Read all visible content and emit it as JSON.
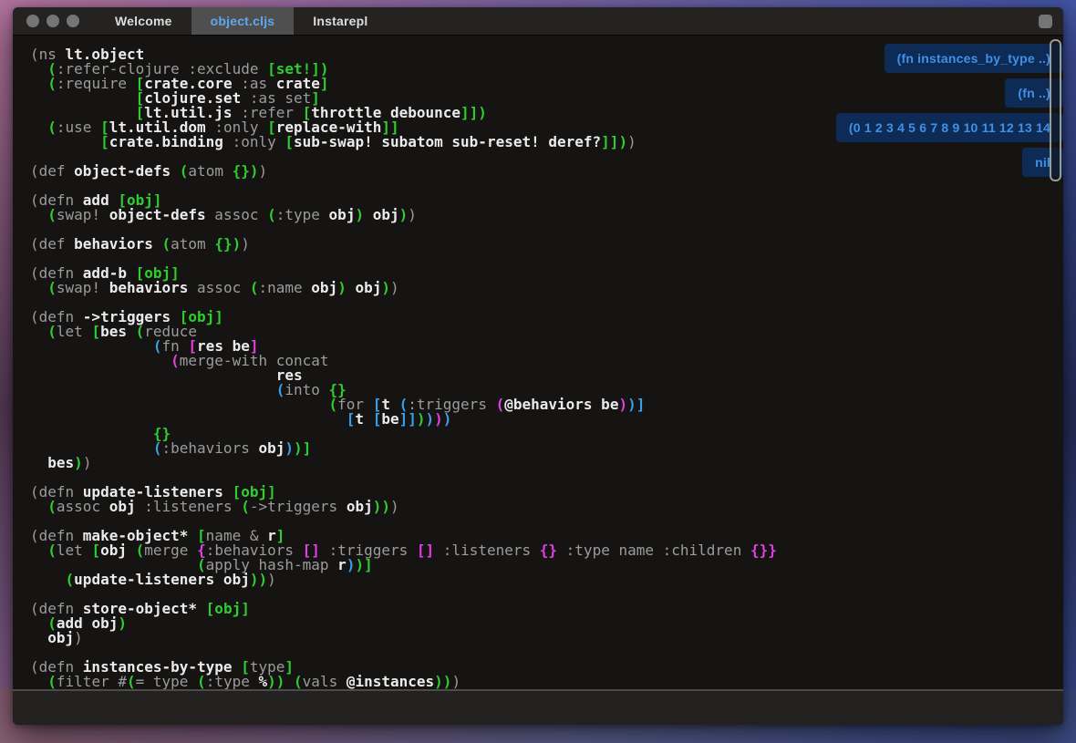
{
  "tabbar": {
    "window_controls": [
      {
        "name": "close-button"
      },
      {
        "name": "minimize-button"
      },
      {
        "name": "zoom-button"
      }
    ],
    "tabs": [
      {
        "label": "Welcome",
        "active": false
      },
      {
        "label": "object.cljs",
        "active": true
      },
      {
        "label": "Instarepl",
        "active": false
      }
    ],
    "console_button": {
      "name": "console-toggle-button"
    }
  },
  "colors": {
    "tab_active_text": "#5da9f0",
    "badge_bg": "#0d2b55",
    "badge_text": "#3f90e8",
    "paren_green": "#2fce2f",
    "paren_blue": "#3c9fe8",
    "paren_magenta": "#e040e0",
    "symbol_white": "#ebebeb",
    "default_gray": "#9c9c9c"
  },
  "editor": {
    "inline_results": [
      {
        "label": "(fn instances_by_type ..)"
      },
      {
        "label": "(fn  ..)"
      },
      {
        "label": "(0 1 2 3 4 5 6 7 8 9 10 11 12 13 14"
      },
      {
        "label": "nil"
      }
    ],
    "lines": [
      [
        [
          "g",
          "(ns "
        ],
        [
          "w",
          "lt.object"
        ]
      ],
      [
        [
          "g",
          "  "
        ],
        [
          "G",
          "("
        ],
        [
          "g",
          ":refer-clojure :exclude "
        ],
        [
          "G",
          "["
        ],
        [
          "G",
          "set!"
        ],
        [
          "G",
          "])"
        ]
      ],
      [
        [
          "g",
          "  "
        ],
        [
          "G",
          "("
        ],
        [
          "g",
          ":require "
        ],
        [
          "G",
          "["
        ],
        [
          "w",
          "crate.core"
        ],
        [
          "g",
          " :as "
        ],
        [
          "w",
          "crate"
        ],
        [
          "G",
          "]"
        ]
      ],
      [
        [
          "g",
          "            "
        ],
        [
          "G",
          "["
        ],
        [
          "w",
          "clojure.set"
        ],
        [
          "g",
          " :as set"
        ],
        [
          "G",
          "]"
        ]
      ],
      [
        [
          "g",
          "            "
        ],
        [
          "G",
          "["
        ],
        [
          "w",
          "lt.util.js"
        ],
        [
          "g",
          " :refer "
        ],
        [
          "G",
          "["
        ],
        [
          "w",
          "throttle debounce"
        ],
        [
          "G",
          "]])"
        ]
      ],
      [
        [
          "g",
          "  "
        ],
        [
          "G",
          "("
        ],
        [
          "g",
          ":use "
        ],
        [
          "G",
          "["
        ],
        [
          "w",
          "lt.util.dom"
        ],
        [
          "g",
          " :only "
        ],
        [
          "G",
          "["
        ],
        [
          "w",
          "replace-with"
        ],
        [
          "G",
          "]]"
        ]
      ],
      [
        [
          "g",
          "        "
        ],
        [
          "G",
          "["
        ],
        [
          "w",
          "crate.binding"
        ],
        [
          "g",
          " :only "
        ],
        [
          "G",
          "["
        ],
        [
          "w",
          "sub-swap! subatom sub-reset! deref?"
        ],
        [
          "G",
          "]])"
        ],
        [
          "g",
          ")"
        ]
      ],
      [],
      [
        [
          "g",
          "(def "
        ],
        [
          "w",
          "object-defs"
        ],
        [
          "g",
          " "
        ],
        [
          "G",
          "("
        ],
        [
          "g",
          "atom "
        ],
        [
          "G",
          "{})"
        ],
        [
          "g",
          ")"
        ]
      ],
      [],
      [
        [
          "g",
          "(defn "
        ],
        [
          "w",
          "add"
        ],
        [
          "g",
          " "
        ],
        [
          "G",
          "[obj]"
        ]
      ],
      [
        [
          "g",
          "  "
        ],
        [
          "G",
          "("
        ],
        [
          "g",
          "swap! "
        ],
        [
          "w",
          "object-defs"
        ],
        [
          "g",
          " assoc "
        ],
        [
          "G",
          "("
        ],
        [
          "g",
          ":type "
        ],
        [
          "w",
          "obj"
        ],
        [
          "G",
          ")"
        ],
        [
          "g",
          " "
        ],
        [
          "w",
          "obj"
        ],
        [
          "G",
          ")"
        ],
        [
          "g",
          ")"
        ]
      ],
      [],
      [
        [
          "g",
          "(def "
        ],
        [
          "w",
          "behaviors"
        ],
        [
          "g",
          " "
        ],
        [
          "G",
          "("
        ],
        [
          "g",
          "atom "
        ],
        [
          "G",
          "{})"
        ],
        [
          "g",
          ")"
        ]
      ],
      [],
      [
        [
          "g",
          "(defn "
        ],
        [
          "w",
          "add-b"
        ],
        [
          "g",
          " "
        ],
        [
          "G",
          "[obj]"
        ]
      ],
      [
        [
          "g",
          "  "
        ],
        [
          "G",
          "("
        ],
        [
          "g",
          "swap! "
        ],
        [
          "w",
          "behaviors"
        ],
        [
          "g",
          " assoc "
        ],
        [
          "G",
          "("
        ],
        [
          "g",
          ":name "
        ],
        [
          "w",
          "obj"
        ],
        [
          "G",
          ")"
        ],
        [
          "g",
          " "
        ],
        [
          "w",
          "obj"
        ],
        [
          "G",
          ")"
        ],
        [
          "g",
          ")"
        ]
      ],
      [],
      [
        [
          "g",
          "(defn "
        ],
        [
          "w",
          "->triggers"
        ],
        [
          "g",
          " "
        ],
        [
          "G",
          "[obj]"
        ]
      ],
      [
        [
          "g",
          "  "
        ],
        [
          "G",
          "("
        ],
        [
          "g",
          "let "
        ],
        [
          "G",
          "["
        ],
        [
          "w",
          "bes"
        ],
        [
          "g",
          " "
        ],
        [
          "G",
          "("
        ],
        [
          "g",
          "reduce"
        ]
      ],
      [
        [
          "g",
          "              "
        ],
        [
          "B",
          "("
        ],
        [
          "g",
          "fn "
        ],
        [
          "M",
          "["
        ],
        [
          "w",
          "res be"
        ],
        [
          "M",
          "]"
        ]
      ],
      [
        [
          "g",
          "                "
        ],
        [
          "M",
          "("
        ],
        [
          "g",
          "merge-with concat"
        ]
      ],
      [
        [
          "g",
          "                            "
        ],
        [
          "w",
          "res"
        ]
      ],
      [
        [
          "g",
          "                            "
        ],
        [
          "B",
          "("
        ],
        [
          "g",
          "into "
        ],
        [
          "G",
          "{}"
        ]
      ],
      [
        [
          "g",
          "                                  "
        ],
        [
          "G",
          "("
        ],
        [
          "g",
          "for "
        ],
        [
          "B",
          "["
        ],
        [
          "w",
          "t"
        ],
        [
          "g",
          " "
        ],
        [
          "B",
          "("
        ],
        [
          "g",
          ":triggers "
        ],
        [
          "M",
          "("
        ],
        [
          "w",
          "@behaviors be"
        ],
        [
          "M",
          ")"
        ],
        [
          "B",
          ")]"
        ]
      ],
      [
        [
          "g",
          "                                    "
        ],
        [
          "B",
          "["
        ],
        [
          "w",
          "t"
        ],
        [
          "g",
          " "
        ],
        [
          "B",
          "["
        ],
        [
          "w",
          "be"
        ],
        [
          "B",
          "]]"
        ],
        [
          "G",
          ")"
        ],
        [
          "B",
          ")"
        ],
        [
          "M",
          ")"
        ],
        [
          "B",
          ")"
        ]
      ],
      [
        [
          "g",
          "              "
        ],
        [
          "G",
          "{}"
        ]
      ],
      [
        [
          "g",
          "              "
        ],
        [
          "B",
          "("
        ],
        [
          "g",
          ":behaviors "
        ],
        [
          "w",
          "obj"
        ],
        [
          "B",
          ")"
        ],
        [
          "G",
          ")]"
        ]
      ],
      [
        [
          "g",
          "  "
        ],
        [
          "w",
          "bes"
        ],
        [
          "G",
          ")"
        ],
        [
          "g",
          ")"
        ]
      ],
      [],
      [
        [
          "g",
          "(defn "
        ],
        [
          "w",
          "update-listeners"
        ],
        [
          "g",
          " "
        ],
        [
          "G",
          "[obj]"
        ]
      ],
      [
        [
          "g",
          "  "
        ],
        [
          "G",
          "("
        ],
        [
          "g",
          "assoc "
        ],
        [
          "w",
          "obj"
        ],
        [
          "g",
          " :listeners "
        ],
        [
          "G",
          "("
        ],
        [
          "g",
          "->triggers "
        ],
        [
          "w",
          "obj"
        ],
        [
          "G",
          "))"
        ],
        [
          "g",
          ")"
        ]
      ],
      [],
      [
        [
          "g",
          "(defn "
        ],
        [
          "w",
          "make-object*"
        ],
        [
          "g",
          " "
        ],
        [
          "G",
          "["
        ],
        [
          "g",
          "name & "
        ],
        [
          "w",
          "r"
        ],
        [
          "G",
          "]"
        ]
      ],
      [
        [
          "g",
          "  "
        ],
        [
          "G",
          "("
        ],
        [
          "g",
          "let "
        ],
        [
          "G",
          "["
        ],
        [
          "w",
          "obj"
        ],
        [
          "g",
          " "
        ],
        [
          "G",
          "("
        ],
        [
          "g",
          "merge "
        ],
        [
          "M",
          "{"
        ],
        [
          "g",
          ":behaviors "
        ],
        [
          "M",
          "[]"
        ],
        [
          "g",
          " :triggers "
        ],
        [
          "M",
          "[]"
        ],
        [
          "g",
          " :listeners "
        ],
        [
          "M",
          "{}"
        ],
        [
          "g",
          " :type name :children "
        ],
        [
          "M",
          "{}}"
        ]
      ],
      [
        [
          "g",
          "                   "
        ],
        [
          "G",
          "("
        ],
        [
          "g",
          "apply hash-map "
        ],
        [
          "w",
          "r"
        ],
        [
          "B",
          ")"
        ],
        [
          "G",
          ")]"
        ]
      ],
      [
        [
          "g",
          "    "
        ],
        [
          "G",
          "("
        ],
        [
          "w",
          "update-listeners obj"
        ],
        [
          "G",
          "))"
        ],
        [
          "g",
          ")"
        ]
      ],
      [],
      [
        [
          "g",
          "(defn "
        ],
        [
          "w",
          "store-object*"
        ],
        [
          "g",
          " "
        ],
        [
          "G",
          "[obj]"
        ]
      ],
      [
        [
          "g",
          "  "
        ],
        [
          "G",
          "("
        ],
        [
          "w",
          "add obj"
        ],
        [
          "G",
          ")"
        ]
      ],
      [
        [
          "g",
          "  "
        ],
        [
          "w",
          "obj"
        ],
        [
          "g",
          ")"
        ]
      ],
      [],
      [
        [
          "g",
          "(defn "
        ],
        [
          "w",
          "instances-by-type"
        ],
        [
          "g",
          " "
        ],
        [
          "G",
          "["
        ],
        [
          "g",
          "type"
        ],
        [
          "G",
          "]"
        ]
      ],
      [
        [
          "g",
          "  "
        ],
        [
          "G",
          "("
        ],
        [
          "g",
          "filter #"
        ],
        [
          "G",
          "("
        ],
        [
          "g",
          "= type "
        ],
        [
          "G",
          "("
        ],
        [
          "g",
          ":type "
        ],
        [
          "w",
          "%"
        ],
        [
          "G",
          "))"
        ],
        [
          "g",
          " "
        ],
        [
          "G",
          "("
        ],
        [
          "g",
          "vals "
        ],
        [
          "w",
          "@instances"
        ],
        [
          "G",
          "))"
        ],
        [
          "g",
          ")"
        ]
      ]
    ]
  }
}
